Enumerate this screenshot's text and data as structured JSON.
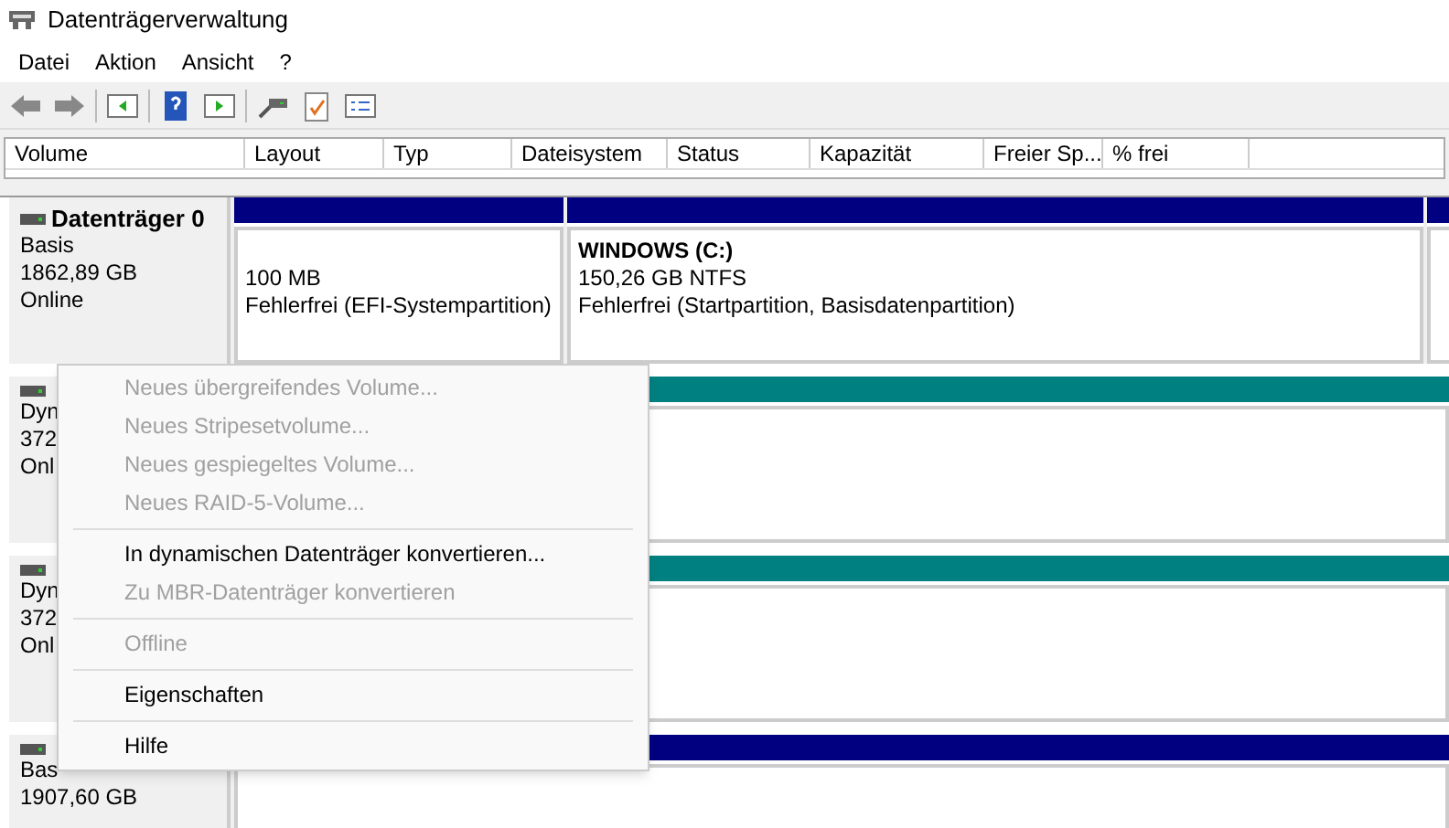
{
  "window": {
    "title": "Datenträgerverwaltung"
  },
  "menu_bar": [
    "Datei",
    "Aktion",
    "Ansicht",
    "?"
  ],
  "volume_table": {
    "columns": [
      "Volume",
      "Layout",
      "Typ",
      "Dateisystem",
      "Status",
      "Kapazität",
      "Freier Sp...",
      "% frei"
    ]
  },
  "disks": [
    {
      "name": "Datenträger 0",
      "type": "Basis",
      "size": "1862,89 GB",
      "status": "Online",
      "partitions": [
        {
          "size": "100 MB",
          "health": "Fehlerfrei (EFI-Systempartition)",
          "color": "#000080"
        },
        {
          "name": "WINDOWS  (C:)",
          "size": "150,26 GB NTFS",
          "health": "Fehlerfrei (Startpartition, Basisdatenpartition)",
          "color": "#000080"
        },
        {
          "color": "#000080"
        }
      ]
    },
    {
      "type": "Dyn",
      "size": "372",
      "status": "Onl",
      "partitions": [
        {
          "color": "#008080"
        }
      ]
    },
    {
      "type": "Dyn",
      "size": "372",
      "status": "Onl",
      "partitions": [
        {
          "color": "#008080"
        }
      ]
    },
    {
      "type": "Bas",
      "size": "1907,60 GB",
      "partitions": [
        {
          "color": "#000080"
        }
      ]
    }
  ],
  "context_menu": [
    {
      "kind": "item",
      "label": "Neues übergreifendes Volume...",
      "disabled": true
    },
    {
      "kind": "item",
      "label": "Neues Stripesetvolume...",
      "disabled": true
    },
    {
      "kind": "item",
      "label": "Neues gespiegeltes Volume...",
      "disabled": true
    },
    {
      "kind": "item",
      "label": "Neues RAID-5-Volume...",
      "disabled": true
    },
    {
      "kind": "separator"
    },
    {
      "kind": "item",
      "label": "In dynamischen Datenträger konvertieren...",
      "disabled": false
    },
    {
      "kind": "item",
      "label": "Zu MBR-Datenträger konvertieren",
      "disabled": true
    },
    {
      "kind": "separator"
    },
    {
      "kind": "item",
      "label": "Offline",
      "disabled": true
    },
    {
      "kind": "separator"
    },
    {
      "kind": "item",
      "label": "Eigenschaften",
      "disabled": false
    },
    {
      "kind": "separator"
    },
    {
      "kind": "item",
      "label": "Hilfe",
      "disabled": false
    }
  ]
}
